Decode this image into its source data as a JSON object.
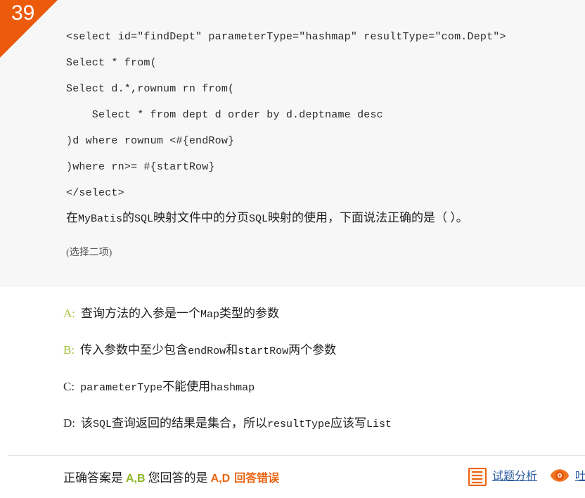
{
  "badge": {
    "number": "39"
  },
  "colors": {
    "accent_orange": "#ec5b0c",
    "correct_green": "#8cb423",
    "wrong_orange": "#ea6410",
    "link_blue": "#2b5aa0",
    "panel_gray": "#f7f7f7"
  },
  "question": {
    "code_lines": [
      "<select id=\"findDept\" parameterType=\"hashmap\" resultType=\"com.Dept\">",
      "Select * from(",
      "Select d.*,rownum rn from(",
      "    Select * from dept d order by d.deptname desc",
      ")d where rownum <#{endRow}",
      ")where rn>= #{startRow}",
      "</select>"
    ],
    "stem_prefix": "在",
    "stem_mono1": "MyBatis",
    "stem_mid1": "的",
    "stem_mono2": "SQL",
    "stem_mid2": "映射文件中的分页",
    "stem_mono3": "SQL",
    "stem_suffix": "映射的使用，下面说法正确的是（  ）。",
    "select_count_note": "(选择二项)"
  },
  "options": [
    {
      "key": "A:",
      "state": "correct",
      "text_before": "查询方法的入参是一个",
      "mono": "Map",
      "text_after": "类型的参数"
    },
    {
      "key": "B:",
      "state": "correct",
      "text_before": "传入参数中至少包含",
      "mono": "endRow",
      "text_mid": "和",
      "mono2": "startRow",
      "text_after": "两个参数"
    },
    {
      "key": "C:",
      "state": "plain",
      "mono_lead": "parameterType",
      "text_before": "不能使用",
      "mono": "hashmap",
      "text_after": ""
    },
    {
      "key": "D:",
      "state": "plain",
      "text_before": "该",
      "mono_lead": "SQL",
      "text_mid": "查询返回的结果是集合，所以",
      "mono": "resultType",
      "text_after": "应该写",
      "mono2": "List"
    }
  ],
  "answer_bar": {
    "correct_label": "正确答案是",
    "correct_value": "A,B",
    "your_label": "您回答的是",
    "your_value": "A,D",
    "verdict": "回答错误",
    "actions": [
      {
        "icon": "document-lines-icon",
        "label": "试题分析"
      },
      {
        "icon": "eye-icon",
        "label": "吐槽"
      }
    ]
  }
}
